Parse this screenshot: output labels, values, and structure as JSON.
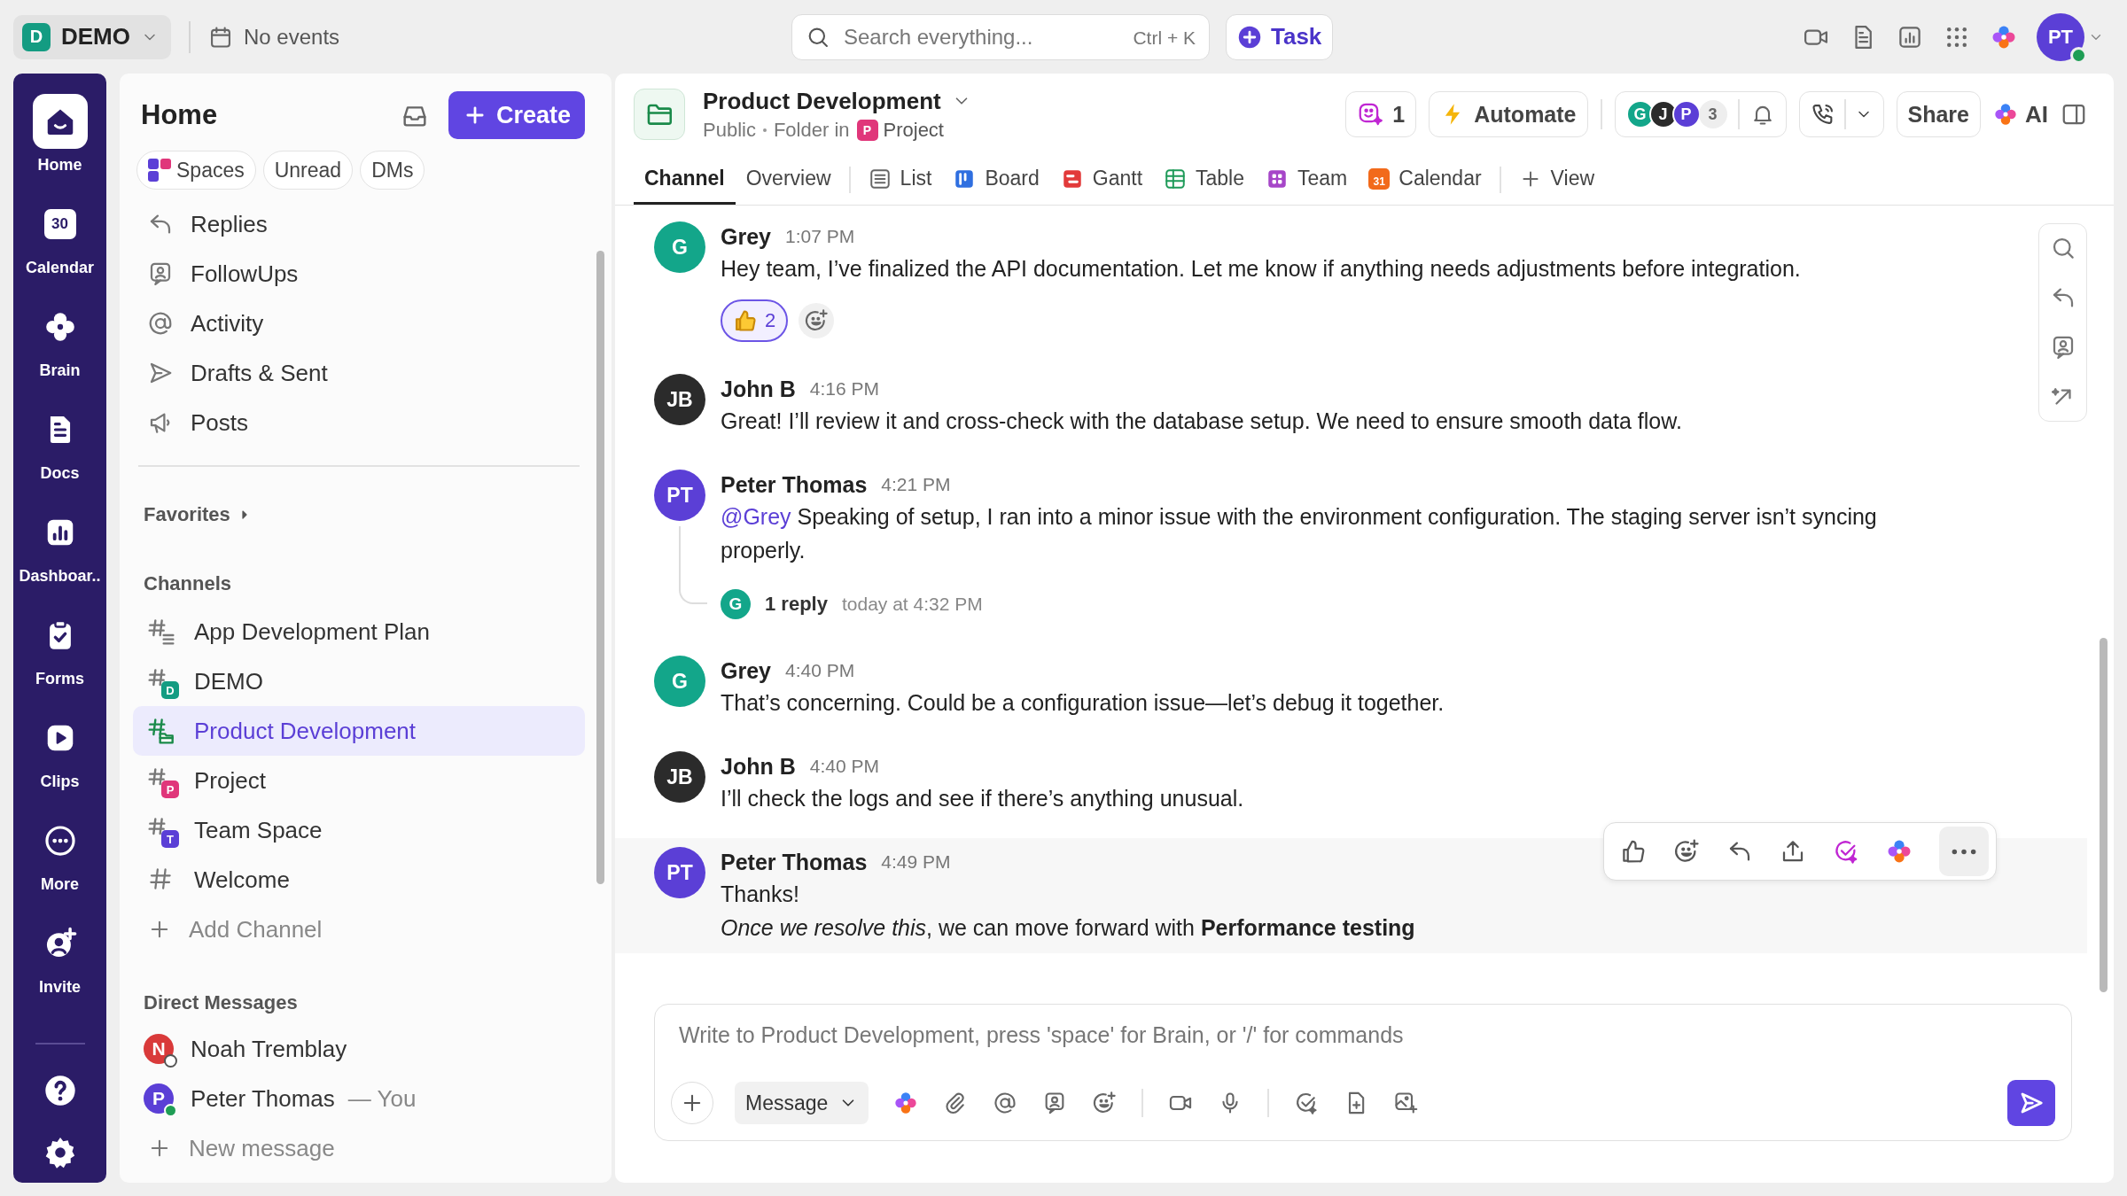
{
  "top_bar": {
    "workspace": {
      "initial": "D",
      "name": "DEMO",
      "color": "#149c82"
    },
    "events": "No events",
    "search": {
      "placeholder": "Search everything...",
      "shortcut": "Ctrl + K"
    },
    "task_button": "Task",
    "user": {
      "initials": "PT",
      "online": true
    }
  },
  "rail": {
    "items": [
      {
        "label": "Home",
        "selected": true
      },
      {
        "label": "Calendar",
        "selected": false,
        "badge": "30"
      },
      {
        "label": "Brain",
        "selected": false
      },
      {
        "label": "Docs",
        "selected": false
      },
      {
        "label": "Dashboar..",
        "selected": false
      },
      {
        "label": "Forms",
        "selected": false
      },
      {
        "label": "Clips",
        "selected": false
      },
      {
        "label": "More",
        "selected": false
      },
      {
        "label": "Invite",
        "selected": false
      }
    ]
  },
  "sidebar": {
    "title": "Home",
    "create_button": "Create",
    "filters": [
      {
        "label": "Spaces",
        "selected": false
      },
      {
        "label": "Unread",
        "selected": false
      },
      {
        "label": "DMs",
        "selected": false
      }
    ],
    "nav": [
      {
        "label": "Replies",
        "selected": false
      },
      {
        "label": "FollowUps",
        "selected": false
      },
      {
        "label": "Activity",
        "selected": false
      },
      {
        "label": "Drafts & Sent",
        "selected": false
      },
      {
        "label": "Posts",
        "selected": false
      }
    ],
    "favorites": "Favorites",
    "channels_heading": "Channels",
    "channels": [
      {
        "name": "App Development Plan",
        "kind": "list",
        "selected": false
      },
      {
        "name": "DEMO",
        "kind": "badge",
        "badge": "D",
        "color": "#149c82",
        "selected": false
      },
      {
        "name": "Product Development",
        "kind": "folder",
        "selected": true
      },
      {
        "name": "Project",
        "kind": "badge",
        "badge": "P",
        "color": "#e0367a",
        "selected": false
      },
      {
        "name": "Team Space",
        "kind": "badge",
        "badge": "T",
        "color": "#5b3fd6",
        "selected": false
      },
      {
        "name": "Welcome",
        "kind": "plain",
        "selected": false
      }
    ],
    "add_channel": "Add Channel",
    "dm_heading": "Direct Messages",
    "dms": [
      {
        "name": "Noah Tremblay",
        "initial": "N",
        "color": "#d93a3a",
        "online": false,
        "selected": false
      },
      {
        "name": "Peter Thomas",
        "note": "— You",
        "initial": "P",
        "color": "#5b3fd6",
        "online": true,
        "selected": false
      }
    ],
    "new_message": "New message"
  },
  "channel": {
    "name": "Product Development",
    "visibility": "Public",
    "location_label": "Folder in",
    "location": {
      "initial": "P",
      "name": "Project",
      "color": "#e0367a"
    },
    "agents_count": "1",
    "automate_button": "Automate",
    "members": [
      {
        "initial": "G",
        "color": "#13a68a"
      },
      {
        "initial": "J",
        "color": "#2b2b2b"
      },
      {
        "initial": "P",
        "color": "#5b3fd6"
      }
    ],
    "member_count": "3",
    "share_button": "Share",
    "ai_button": "AI",
    "tabs": [
      {
        "label": "Channel",
        "kind": "text",
        "selected": true
      },
      {
        "label": "Overview",
        "kind": "text",
        "selected": false
      },
      {
        "label": "List",
        "kind": "list",
        "selected": false
      },
      {
        "label": "Board",
        "kind": "board",
        "selected": false
      },
      {
        "label": "Gantt",
        "kind": "gantt",
        "selected": false
      },
      {
        "label": "Table",
        "kind": "table",
        "selected": false
      },
      {
        "label": "Team",
        "kind": "team",
        "selected": false
      },
      {
        "label": "Calendar",
        "kind": "calendar",
        "badge": "31",
        "selected": false
      }
    ],
    "add_view": "View",
    "messages": [
      {
        "author": "Grey",
        "initials": "G",
        "color": "#13a68a",
        "time": "1:07 PM",
        "hovered": false,
        "lines": [
          "Hey team, I’ve finalized the API documentation. Let me know if anything needs adjustments before integration."
        ],
        "reactions": [
          {
            "count": "2",
            "selected": true
          }
        ]
      },
      {
        "author": "John B",
        "initials": "JB",
        "color": "#2b2b2b",
        "time": "4:16 PM",
        "hovered": false,
        "lines": [
          "Great! I’ll review it and cross-check with the database setup. We need to ensure smooth data flow."
        ]
      },
      {
        "author": "Peter Thomas",
        "initials": "PT",
        "color": "#5b3fd6",
        "time": "4:21 PM",
        "hovered": false,
        "mention": "@Grey",
        "lines": [
          "Speaking of setup, I ran into a minor issue with the environment configuration. The staging server isn’t syncing properly."
        ],
        "thread": {
          "initial": "G",
          "color": "#13a68a",
          "replies": "1 reply",
          "time": "today at 4:32 PM"
        }
      },
      {
        "author": "Grey",
        "initials": "G",
        "color": "#13a68a",
        "time": "4:40 PM",
        "hovered": false,
        "lines": [
          "That’s concerning. Could be a configuration issue—let’s debug it together."
        ]
      },
      {
        "author": "John B",
        "initials": "JB",
        "color": "#2b2b2b",
        "time": "4:40 PM",
        "hovered": false,
        "lines": [
          "I’ll check the logs and see if there’s anything unusual."
        ]
      },
      {
        "author": "Peter Thomas",
        "initials": "PT",
        "color": "#5b3fd6",
        "time": "4:49 PM",
        "hovered": true,
        "lines": [
          "Thanks!",
          "*Once we resolve this*, we can move forward with **Performance testing**"
        ]
      }
    ],
    "composer": {
      "placeholder": "Write to Product Development, press 'space' for Brain, or '/' for commands",
      "mode": "Message"
    }
  }
}
